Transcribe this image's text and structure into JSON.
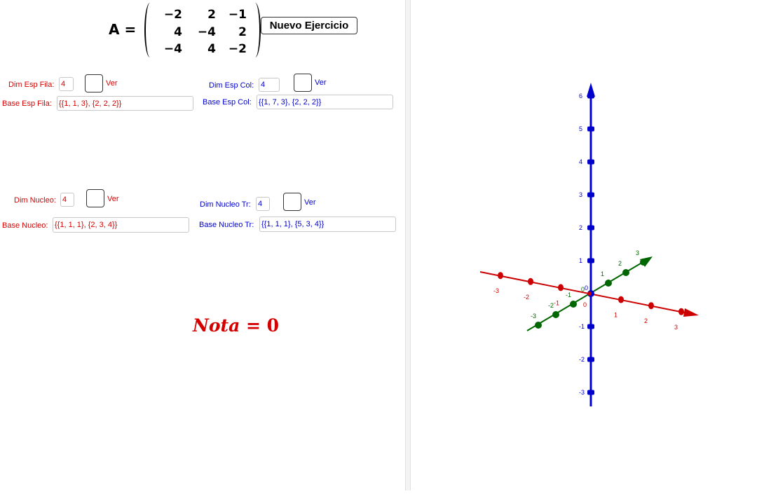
{
  "matrix": {
    "label": "A =",
    "rows": [
      [
        "−2",
        "2",
        "−1"
      ],
      [
        "4",
        "−4",
        "2"
      ],
      [
        "−4",
        "4",
        "−2"
      ]
    ]
  },
  "new_exercise_label": "Nuevo Ejercicio",
  "row_space": {
    "dim_label": "Dim Esp Fila:",
    "dim_value": "4",
    "ver_label": "Ver",
    "base_label": "Base Esp Fila:",
    "base_value": "{{1, 1, 3}, {2, 2, 2}}"
  },
  "col_space": {
    "dim_label": "Dim Esp Col:",
    "dim_value": "4",
    "ver_label": "Ver",
    "base_label": "Base Esp Col:",
    "base_value": "{{1, 7, 3}, {2, 2, 2}}"
  },
  "kernel": {
    "dim_label": "Dim Nucleo:",
    "dim_value": "4",
    "ver_label": "Ver",
    "base_label": "Base Nucleo:",
    "base_value": "{{1, 1, 1}, {2, 3, 4}}"
  },
  "kernel_tr": {
    "dim_label": "Dim Nucleo Tr:",
    "dim_value": "4",
    "ver_label": "Ver",
    "base_label": "Base Nucleo Tr:",
    "base_value": "{{1, 1, 1}, {5, 3, 4}}"
  },
  "nota": {
    "label": "Nota",
    "eq": " = ",
    "value": "0"
  },
  "graph3d": {
    "colors": {
      "x": "#cc0000",
      "y": "#006600",
      "z": "#0000cc"
    },
    "z_ticks": [
      "6",
      "5",
      "4",
      "3",
      "2",
      "1",
      "-1",
      "-2",
      "-3"
    ],
    "x_ticks": [
      "-3",
      "-2",
      "-1",
      "1",
      "2",
      "3"
    ],
    "y_ticks": [
      "-3",
      "-2",
      "-1",
      "1",
      "2",
      "3"
    ],
    "origin_labels": [
      "0",
      "0",
      "0"
    ]
  }
}
